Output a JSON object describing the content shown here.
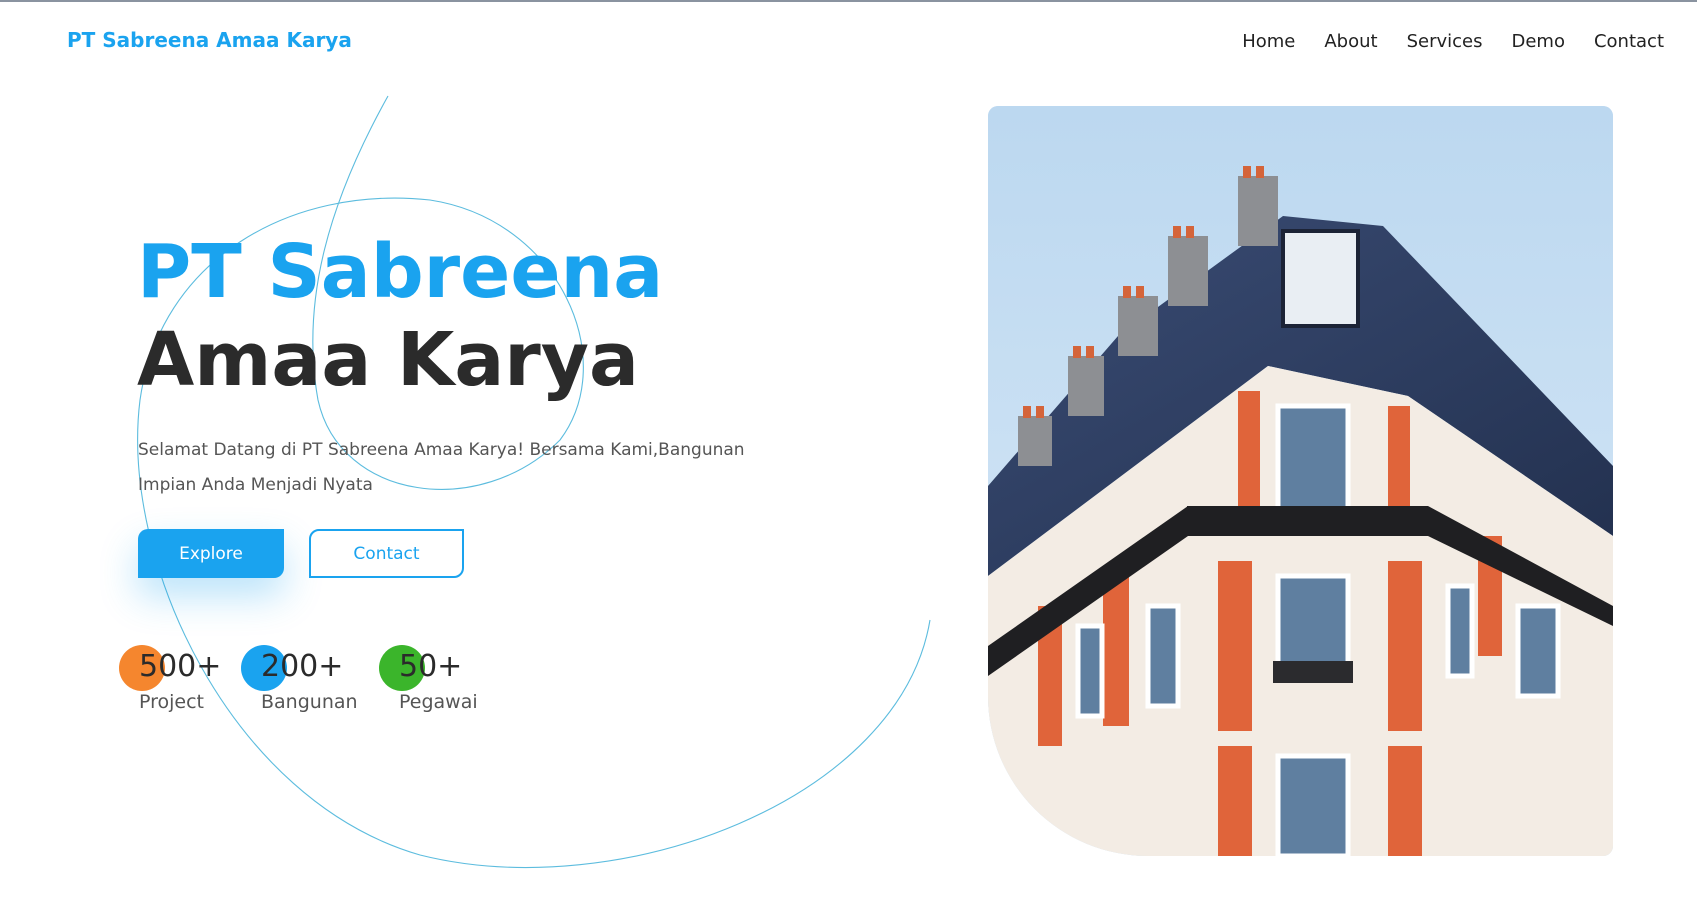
{
  "brand": {
    "name": "PT Sabreena Amaa Karya"
  },
  "nav": {
    "items": [
      "Home",
      "About",
      "Services",
      "Demo",
      "Contact"
    ]
  },
  "hero": {
    "title_line1": "PT Sabreena",
    "title_line2": "Amaa Karya",
    "subtitle": "Selamat Datang di PT Sabreena Amaa Karya! Bersama Kami,Bangunan Impian Anda Menjadi Nyata",
    "explore_label": "Explore",
    "contact_label": "Contact"
  },
  "stats": [
    {
      "value": "500+",
      "label": "Project",
      "color": "#f5862e"
    },
    {
      "value": "200+",
      "label": "Bangunan",
      "color": "#1aa3ef"
    },
    {
      "value": "50+",
      "label": "Pegawai",
      "color": "#3bb52b"
    }
  ],
  "colors": {
    "accent": "#1aa3ef",
    "heading_dark": "#2b2b2b",
    "text_muted": "#555555"
  }
}
